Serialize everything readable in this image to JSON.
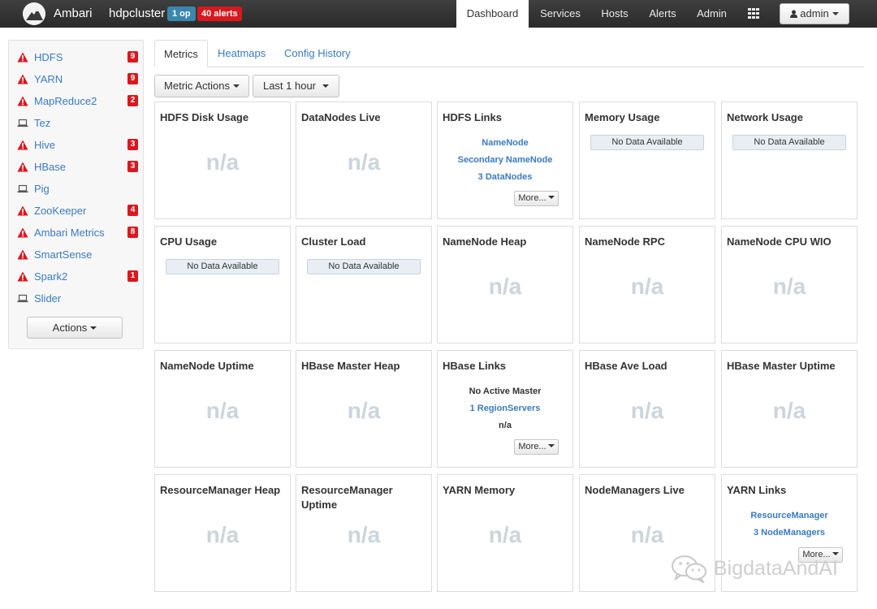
{
  "navbar": {
    "brand": "Ambari",
    "cluster_name": "hdpcluster",
    "ops_badge": "1 op",
    "alerts_badge": "40 alerts",
    "items": [
      {
        "label": "Dashboard",
        "active": true
      },
      {
        "label": "Services",
        "active": false
      },
      {
        "label": "Hosts",
        "active": false
      },
      {
        "label": "Alerts",
        "active": false
      },
      {
        "label": "Admin",
        "active": false
      }
    ],
    "user_label": "admin"
  },
  "sidebar": {
    "services": [
      {
        "name": "HDFS",
        "icon": "alert-icon",
        "count": "9"
      },
      {
        "name": "YARN",
        "icon": "alert-icon",
        "count": "9"
      },
      {
        "name": "MapReduce2",
        "icon": "alert-icon",
        "count": "2"
      },
      {
        "name": "Tez",
        "icon": "laptop-icon",
        "count": ""
      },
      {
        "name": "Hive",
        "icon": "alert-icon",
        "count": "3"
      },
      {
        "name": "HBase",
        "icon": "alert-icon",
        "count": "3"
      },
      {
        "name": "Pig",
        "icon": "laptop-icon",
        "count": ""
      },
      {
        "name": "ZooKeeper",
        "icon": "alert-icon",
        "count": "4"
      },
      {
        "name": "Ambari Metrics",
        "icon": "alert-icon",
        "count": "8"
      },
      {
        "name": "SmartSense",
        "icon": "alert-icon",
        "count": ""
      },
      {
        "name": "Spark2",
        "icon": "alert-icon",
        "count": "1"
      },
      {
        "name": "Slider",
        "icon": "laptop-icon",
        "count": ""
      }
    ],
    "actions_label": "Actions"
  },
  "tabs": [
    {
      "label": "Metrics",
      "active": true
    },
    {
      "label": "Heatmaps",
      "active": false
    },
    {
      "label": "Config History",
      "active": false
    }
  ],
  "toolbar": {
    "metric_actions_label": "Metric Actions",
    "time_range_label": "Last 1 hour"
  },
  "widgets": {
    "hdfs_disk_usage": {
      "title": "HDFS Disk Usage",
      "value": "n/a"
    },
    "datanodes_live": {
      "title": "DataNodes Live",
      "value": "n/a"
    },
    "hdfs_links": {
      "title": "HDFS Links",
      "link1": "NameNode",
      "link2": "Secondary NameNode",
      "link3": "3 DataNodes",
      "more": "More..."
    },
    "memory_usage": {
      "title": "Memory Usage",
      "status": "No Data Available"
    },
    "network_usage": {
      "title": "Network Usage",
      "status": "No Data Available"
    },
    "cpu_usage": {
      "title": "CPU Usage",
      "status": "No Data Available"
    },
    "cluster_load": {
      "title": "Cluster Load",
      "status": "No Data Available"
    },
    "namenode_heap": {
      "title": "NameNode Heap",
      "value": "n/a"
    },
    "namenode_rpc": {
      "title": "NameNode RPC",
      "value": "n/a"
    },
    "namenode_cpu_wio": {
      "title": "NameNode CPU WIO",
      "value": "n/a"
    },
    "namenode_uptime": {
      "title": "NameNode Uptime",
      "value": "n/a"
    },
    "hbase_master_heap": {
      "title": "HBase Master Heap",
      "value": "n/a"
    },
    "hbase_links": {
      "title": "HBase Links",
      "text1": "No Active Master",
      "link2": "1 RegionServers",
      "text3": "n/a",
      "more": "More..."
    },
    "hbase_ave_load": {
      "title": "HBase Ave Load",
      "value": "n/a"
    },
    "hbase_master_uptime": {
      "title": "HBase Master Uptime",
      "value": "n/a"
    },
    "rm_heap": {
      "title": "ResourceManager Heap",
      "value": "n/a"
    },
    "rm_uptime": {
      "title": "ResourceManager Uptime",
      "value": "n/a"
    },
    "yarn_memory": {
      "title": "YARN Memory",
      "value": "n/a"
    },
    "nodemanagers_live": {
      "title": "NodeManagers Live",
      "value": "n/a"
    },
    "yarn_links": {
      "title": "YARN Links",
      "link1": "ResourceManager",
      "link2": "3 NodeManagers",
      "more": "More..."
    }
  },
  "watermark": {
    "text": "BigdataAndAI"
  },
  "colors": {
    "navbar": "#333333",
    "link": "#3a7bbf",
    "alert_red": "#d9181e",
    "ops_blue": "#3a87ad",
    "na_gray": "#ccd5dc"
  }
}
